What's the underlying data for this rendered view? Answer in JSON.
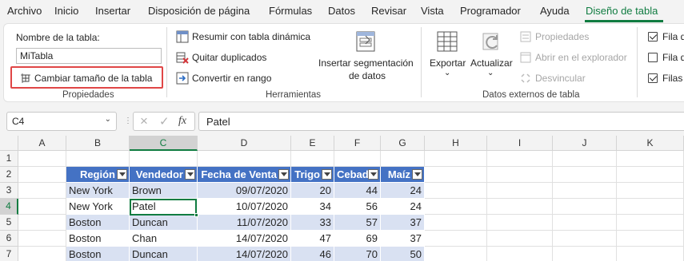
{
  "tabs": [
    "Archivo",
    "Inicio",
    "Insertar",
    "Disposición de página",
    "Fórmulas",
    "Datos",
    "Revisar",
    "Vista",
    "Programador",
    "Ayuda",
    "Diseño de tabla"
  ],
  "ribbon": {
    "properties": {
      "name_label": "Nombre de la tabla:",
      "name_value": "MiTabla",
      "resize_label": "Cambiar tamaño de la tabla",
      "group_label": "Propiedades"
    },
    "tools": {
      "pivot_label": "Resumir con tabla dinámica",
      "remove_dupes_label": "Quitar duplicados",
      "convert_label": "Convertir en rango",
      "slicer_label_1": "Insertar segmentación",
      "slicer_label_2": "de datos",
      "group_label": "Herramientas"
    },
    "external": {
      "export_label": "Exportar",
      "refresh_label": "Actualizar",
      "properties_label": "Propiedades",
      "open_browser_label": "Abrir en el explorador",
      "unlink_label": "Desvincular",
      "group_label": "Datos externos de tabla"
    },
    "style_options": {
      "opt1": "Fila d",
      "opt2": "Fila d",
      "opt3": "Filas"
    }
  },
  "formula_bar": {
    "name_box": "C4",
    "formula": "Patel",
    "cancel_icon": "×",
    "enter_icon": "✓",
    "fx_label": "fx"
  },
  "grid": {
    "columns": [
      "A",
      "B",
      "C",
      "D",
      "E",
      "F",
      "G",
      "H",
      "I",
      "J",
      "K"
    ],
    "rows": [
      "1",
      "2",
      "3",
      "4",
      "5",
      "6",
      "7"
    ],
    "table_headers": [
      "Región",
      "Vendedor",
      "Fecha de Venta",
      "Trigo",
      "Cebada",
      "Maíz"
    ],
    "table_rows": [
      [
        "New York",
        "Brown",
        "09/07/2020",
        "20",
        "44",
        "24"
      ],
      [
        "New York",
        "Patel",
        "10/07/2020",
        "34",
        "56",
        "24"
      ],
      [
        "Boston",
        "Duncan",
        "11/07/2020",
        "33",
        "57",
        "37"
      ],
      [
        "Boston",
        "Chan",
        "14/07/2020",
        "47",
        "69",
        "37"
      ],
      [
        "Boston",
        "Duncan",
        "14/07/2020",
        "46",
        "70",
        "50"
      ]
    ]
  },
  "colors": {
    "accent": "#107c41",
    "table_header": "#4472c4",
    "table_band": "#d9e1f2",
    "highlight_border": "#e04646"
  }
}
